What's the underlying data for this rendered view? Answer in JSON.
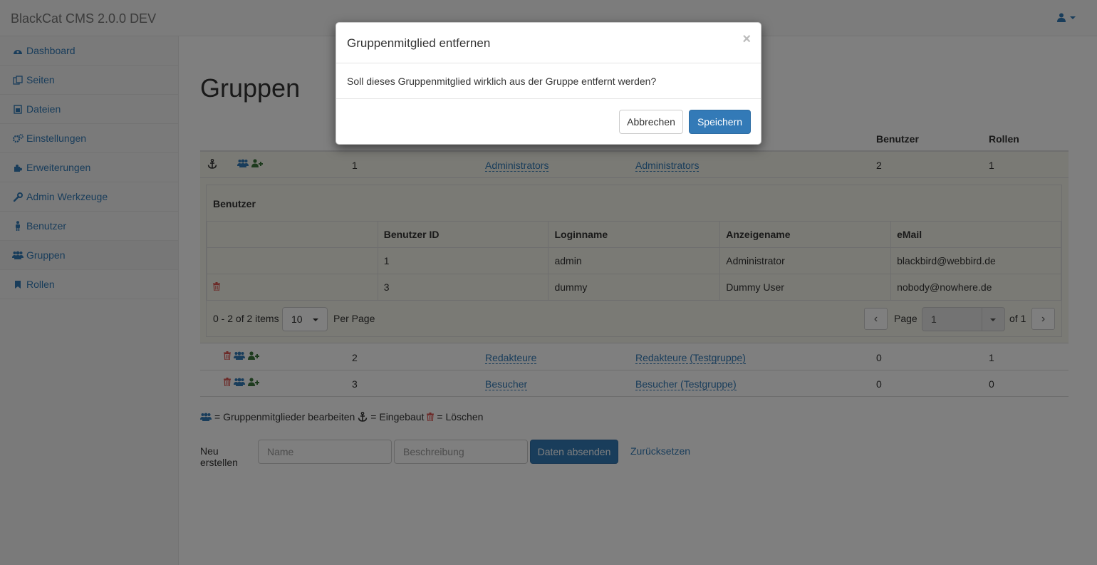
{
  "app": {
    "title": "BlackCat CMS 2.0.0 DEV"
  },
  "sidebar": {
    "items": [
      {
        "label": "Dashboard",
        "icon": "dashboard-icon"
      },
      {
        "label": "Seiten",
        "icon": "pages-icon"
      },
      {
        "label": "Dateien",
        "icon": "file-icon"
      },
      {
        "label": "Einstellungen",
        "icon": "gears-icon"
      },
      {
        "label": "Erweiterungen",
        "icon": "puzzle-icon"
      },
      {
        "label": "Admin Werkzeuge",
        "icon": "wrench-icon"
      },
      {
        "label": "Benutzer",
        "icon": "user-icon"
      },
      {
        "label": "Gruppen",
        "icon": "users-icon",
        "active": true
      },
      {
        "label": "Rollen",
        "icon": "bookmark-icon"
      }
    ]
  },
  "main": {
    "title": "Gruppen",
    "columns": {
      "benutzer": "Benutzer",
      "rollen": "Rollen"
    },
    "groups": [
      {
        "id": "1",
        "name": "Administrators",
        "description": "Administrators",
        "users": "2",
        "roles": "1"
      },
      {
        "id": "2",
        "name": "Redakteure",
        "description": "Redakteure (Testgruppe)",
        "users": "0",
        "roles": "1"
      },
      {
        "id": "3",
        "name": "Besucher",
        "description": "Besucher (Testgruppe)",
        "users": "0",
        "roles": "0"
      }
    ],
    "detail": {
      "title": "Benutzer",
      "headers": [
        "",
        "Benutzer ID",
        "Loginname",
        "Anzeigename",
        "eMail"
      ],
      "rows": [
        [
          "",
          "1",
          "admin",
          "Administrator",
          "blackbird@webbird.de"
        ],
        [
          "",
          "3",
          "dummy",
          "Dummy User",
          "nobody@nowhere.de"
        ]
      ],
      "pager": {
        "items_text": "0 - 2 of 2 items",
        "per_page_value": "10",
        "per_page_label": "Per Page",
        "page_label": "Page",
        "page_value": "1",
        "of_label": "of 1"
      }
    },
    "legend": {
      "members": "= Gruppenmitglieder bearbeiten",
      "builtin": "= Eingebaut",
      "delete": "= Löschen"
    },
    "create": {
      "label": "Neu erstellen",
      "name_placeholder": "Name",
      "desc_placeholder": "Beschreibung",
      "submit": "Daten absenden",
      "reset": "Zurücksetzen"
    }
  },
  "modal": {
    "title": "Gruppenmitglied entfernen",
    "close": "×",
    "body": "Soll dieses Gruppenmitglied wirklich aus der Gruppe entfernt werden?",
    "cancel": "Abbrechen",
    "save": "Speichern"
  },
  "colors": {
    "link": "#337ab7",
    "danger": "#d9534f",
    "success": "#3c763d"
  }
}
